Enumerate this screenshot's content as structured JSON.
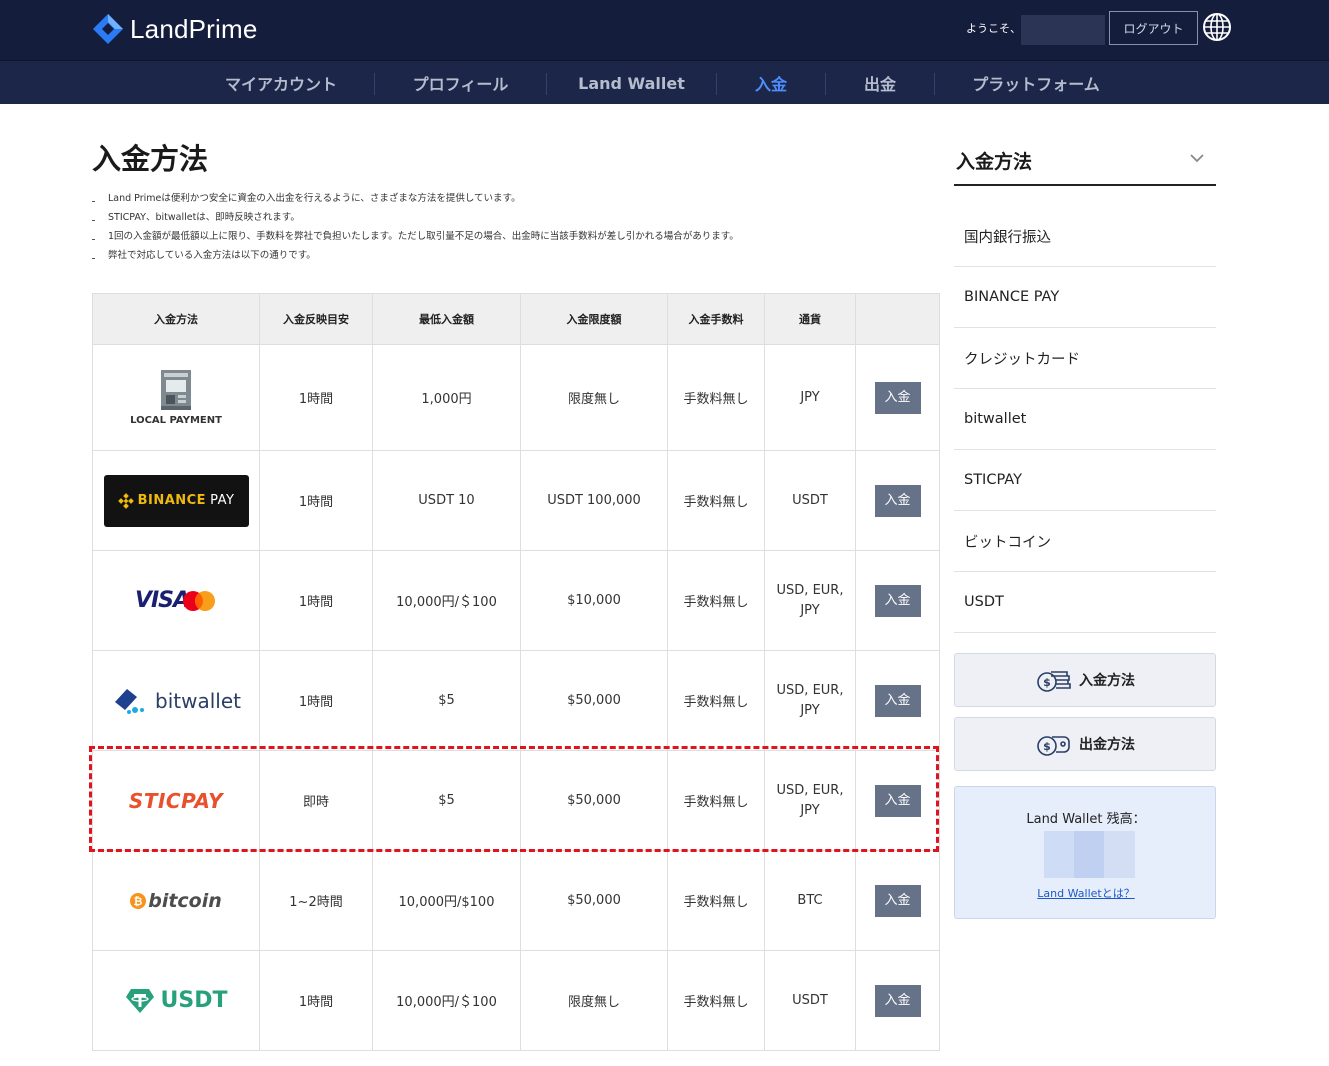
{
  "header": {
    "brand": "LandPrime",
    "welcome": "ようこそ、",
    "logout_label": "ログアウト"
  },
  "nav": [
    {
      "label": "マイアカウント",
      "active": false
    },
    {
      "label": "プロフィール",
      "active": false
    },
    {
      "label": "Land Wallet",
      "active": false
    },
    {
      "label": "入金",
      "active": true
    },
    {
      "label": "出金",
      "active": false
    },
    {
      "label": "プラットフォーム",
      "active": false
    }
  ],
  "main": {
    "title": "入金方法",
    "notes": [
      "Land Primeは便利かつ安全に資金の入出金を行えるように、さまざまな方法を提供しています。",
      "STICPAY、bitwalletは、即時反映されます。",
      "1回の入金額が最低額以上に限り、手数料を弊社で負担いたします。ただし取引量不足の場合、出金時に当該手数料が差し引かれる場合があります。",
      "弊社で対応している入金方法は以下の通りです。"
    ]
  },
  "table": {
    "headers": [
      "入金方法",
      "入金反映目安",
      "最低入金額",
      "入金限度額",
      "入金手数料",
      "通貨",
      ""
    ],
    "deposit_label": "入金",
    "rows": [
      {
        "logo": "LOCAL PAYMENT",
        "time": "1時間",
        "min": "1,000円",
        "limit": "限度無し",
        "fee": "手数料無し",
        "currency": [
          "JPY"
        ]
      },
      {
        "logo_a": "BINANCE",
        "logo_b": "PAY",
        "time": "1時間",
        "min": "USDT 10",
        "limit": "USDT 100,000",
        "fee": "手数料無し",
        "currency": [
          "USDT"
        ]
      },
      {
        "logo": "VISA",
        "time": "1時間",
        "min": "10,000円/＄100",
        "limit": "$10,000",
        "fee": "手数料無し",
        "currency": [
          "USD, EUR,",
          "JPY"
        ]
      },
      {
        "logo": "bitwallet",
        "time": "1時間",
        "min": "$5",
        "limit": "$50,000",
        "fee": "手数料無し",
        "currency": [
          "USD, EUR,",
          "JPY"
        ]
      },
      {
        "logo": "STICPAY",
        "time": "即時",
        "min": "$5",
        "limit": "$50,000",
        "fee": "手数料無し",
        "currency": [
          "USD, EUR,",
          "JPY"
        ]
      },
      {
        "logo": "bitcoin",
        "time": "1~2時間",
        "min": "10,000円/$100",
        "limit": "$50,000",
        "fee": "手数料無し",
        "currency": [
          "BTC"
        ]
      },
      {
        "logo": "USDT",
        "time": "1時間",
        "min": "10,000円/＄100",
        "limit": "限度無し",
        "fee": "手数料無し",
        "currency": [
          "USDT"
        ]
      }
    ]
  },
  "sidebar": {
    "title": "入金方法",
    "items": [
      "国内銀行振込",
      "BINANCE PAY",
      "クレジットカード",
      "bitwallet",
      "STICPAY",
      "ビットコイン",
      "USDT"
    ],
    "deposit_method_btn": "入金方法",
    "withdraw_method_btn": "出金方法",
    "wallet_balance_label": "Land Wallet 残高：",
    "wallet_link": "Land Walletとは？"
  },
  "colors": {
    "header_bg": "#141d3c",
    "nav_bg": "#1b2648",
    "nav_active": "#4f8dff",
    "button_bg": "#667288",
    "highlight": "#e0141e"
  }
}
